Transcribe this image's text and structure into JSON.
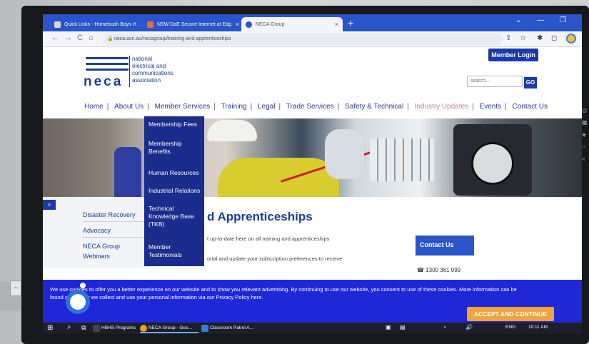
{
  "browser": {
    "tabs": [
      {
        "label": "Quick Links - Homebush Boys H",
        "active": false,
        "fav_color": "#d9d9d9"
      },
      {
        "label": "NSW DoE Secure Internet at Edg",
        "active": false,
        "fav_color": "#e26d3a"
      },
      {
        "label": "NECA Group",
        "active": true,
        "fav_color": "#2a55c8"
      }
    ],
    "tab_close": "×",
    "new_tab": "+",
    "url": "neca.asn.au/necagroup/training-and-apprenticeships",
    "nav": {
      "back": "←",
      "forward": "→",
      "reload": "C",
      "home": "⌂"
    },
    "toolbar_icons": {
      "share": "⇪",
      "star": "☆",
      "extensions": "✱",
      "sidebar": "◻"
    },
    "window_controls": {
      "collapse": "⌄",
      "minimize": "—",
      "restore": "❐"
    }
  },
  "site": {
    "logo": {
      "word": "neca",
      "tagline": [
        "national",
        "electrical and",
        "communications",
        "association"
      ]
    },
    "member_login": "Member Login",
    "search_placeholder": "search...",
    "search_go": "GO",
    "nav": [
      {
        "label": "Home"
      },
      {
        "label": "About Us"
      },
      {
        "label": "Member Services"
      },
      {
        "label": "Training"
      },
      {
        "label": "Legal"
      },
      {
        "label": "Trade Services"
      },
      {
        "label": "Safety & Technical"
      },
      {
        "label": "Industry Updates",
        "muted": true
      },
      {
        "label": "Events"
      },
      {
        "label": "Contact Us"
      }
    ],
    "dropdown": [
      "Membership Fees",
      "Membership Benefits",
      "Human Resources",
      "Industrial Relations",
      "Technical Knowledge Base (TKB)",
      "Member Testimonials"
    ],
    "sidebar_toggle": "»",
    "subnav": [
      "Disaster Recovery",
      "Advocacy",
      "NECA Group"
    ],
    "subnav_partial": "Webinars",
    "heading": "d Apprenticeships",
    "paragraphs": [
      "t up-to-date here on all training and apprenticeships",
      "ortal and update your subscription preferences to receive"
    ],
    "contact": {
      "title": "Contact Us",
      "phone": "☎ 1300 361 099"
    }
  },
  "cookie": {
    "line1": "We use cookies to offer you a better experience on our website and to show you relevant advertising. By continuing to use our website, you consent to use of these cookies. More information can be",
    "line2": "found about how we collect and use your personal information via our Privacy Policy here.",
    "accept": "ACCEPT AND CONTINUE"
  },
  "taskbar": {
    "start": "⊞",
    "search": "⌕",
    "task_view": "⧉",
    "apps": [
      {
        "label": "HBHS Programs",
        "color": "#1c1f2a"
      },
      {
        "label": "NECA Group - Goo...",
        "color": "#e0a020"
      },
      {
        "label": "Classroom Patrol A...",
        "color": "#3a7bd5"
      }
    ],
    "lang": "ENG",
    "time": "10:11 AM"
  }
}
